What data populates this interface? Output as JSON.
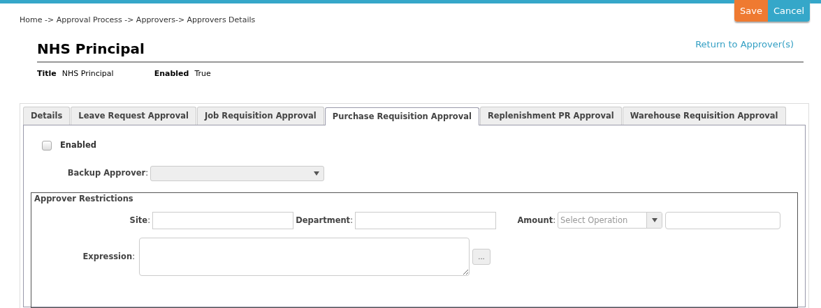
{
  "breadcrumb": "Home -> Approval Process -> Approvers-> Approvers Details",
  "actions": [
    {
      "label": "Save",
      "kind": "save"
    },
    {
      "label": "Cancel",
      "kind": "cancel"
    }
  ],
  "heading": "NHS Principal",
  "return_link": "Return to Approver(s)",
  "summary": [
    {
      "label": "Title",
      "value": "NHS Principal"
    },
    {
      "label": "Enabled",
      "value": "True"
    }
  ],
  "tabs": [
    {
      "label": "Details",
      "selected": false
    },
    {
      "label": "Leave Request Approval",
      "selected": false
    },
    {
      "label": "Job Requisition Approval",
      "selected": false
    },
    {
      "label": "Purchase Requisition Approval",
      "selected": true
    },
    {
      "label": "Replenishment PR Approval",
      "selected": false
    },
    {
      "label": "Warehouse Requisition Approval",
      "selected": false
    }
  ],
  "enabled": {
    "label": "Enabled",
    "checked": false
  },
  "backup_approver": {
    "label": "**Backup Approver**:"
  },
  "restrictions": {
    "legend": "Approver Restrictions",
    "site": {
      "label": "**Site**:"
    },
    "department": {
      "label": "**Department**:"
    },
    "amount": {
      "label": "**Amount**:",
      "placeholder": "Select Operation"
    },
    "expression": {
      "label": "**Expression**:",
      "button": "..."
    }
  }
}
